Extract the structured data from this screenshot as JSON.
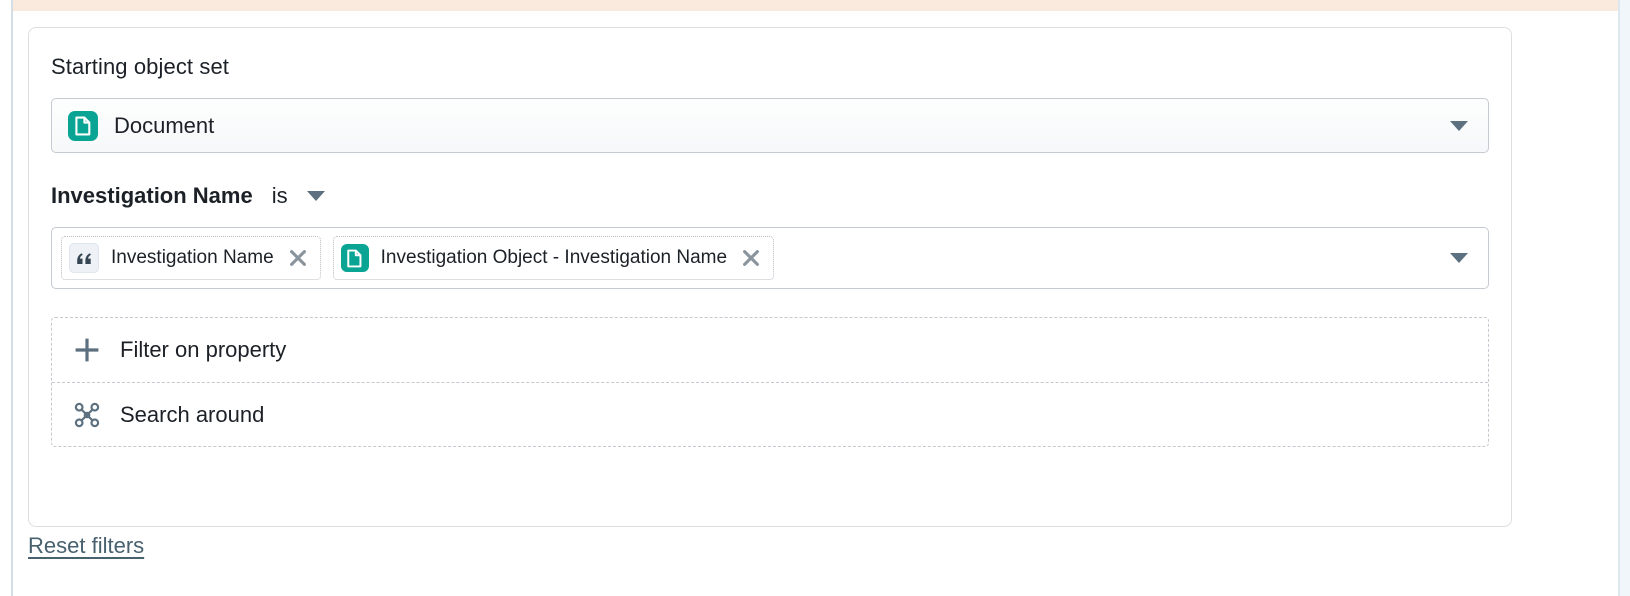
{
  "panel": {
    "starting_object_set_label": "Starting object set",
    "object_set": {
      "value": "Document",
      "icon": "document-icon"
    },
    "condition": {
      "property": "Investigation Name",
      "operator": "is",
      "operator_icon": "chevron-down-icon"
    },
    "chips": [
      {
        "label": "Investigation Name",
        "icon": "quote-icon",
        "remove_icon": "close-icon"
      },
      {
        "label": "Investigation Object - Investigation Name",
        "icon": "document-icon",
        "remove_icon": "close-icon"
      }
    ],
    "actions": [
      {
        "label": "Filter on property",
        "icon": "plus-icon"
      },
      {
        "label": "Search around",
        "icon": "graph-nodes-icon"
      }
    ],
    "reset_link": "Reset filters"
  },
  "colors": {
    "accent_teal": "#0AA494",
    "banner": "#FAEADE",
    "text": "#1C2127",
    "muted": "#5C7080",
    "link": "#48616F",
    "border": "#C5CBD1"
  }
}
